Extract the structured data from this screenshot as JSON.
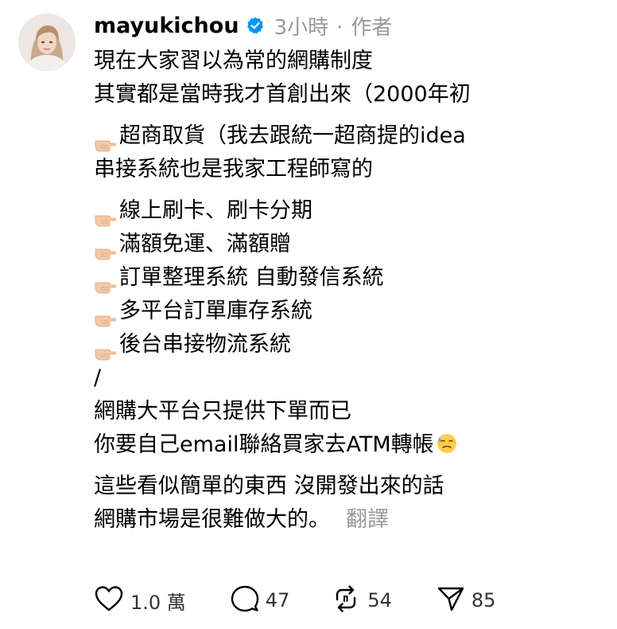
{
  "post": {
    "username": "mayukichou",
    "time": "3小時",
    "separator": "·",
    "author_label": "作者",
    "verified_icon": "verified-badge-icon",
    "lines": {
      "l1": "現在大家習以為常的網購制度",
      "l2": "其實都是當時我才首創出來（2000年初",
      "l3": "超商取貨（我去跟統一超商提的idea",
      "l4": "串接系統也是我家工程師寫的",
      "l5": "線上刷卡、刷卡分期",
      "l6": "滿額免運、滿額贈",
      "l7": "訂單整理系統 自動發信系統",
      "l8": "多平台訂單庫存系統",
      "l9": "後台串接物流系統",
      "l10": "/",
      "l11": "網購大平台只提供下單而已",
      "l12": "你要自己email聯絡買家去ATM轉帳",
      "l13": "這些看似簡單的東西 沒開發出來的話",
      "l14": "網購市場是很難做大的。"
    },
    "translate_label": "翻譯",
    "bullet_icon": "pointing-finger-icon",
    "end_emoji_icon": "anxious-sweat-face-icon"
  },
  "actions": {
    "like_count": "1.0 萬",
    "reply_count": "47",
    "repost_count": "54",
    "share_count": "85"
  },
  "colors": {
    "verified_blue": "#0095f6",
    "meta_gray": "#999999",
    "text": "#000000"
  }
}
